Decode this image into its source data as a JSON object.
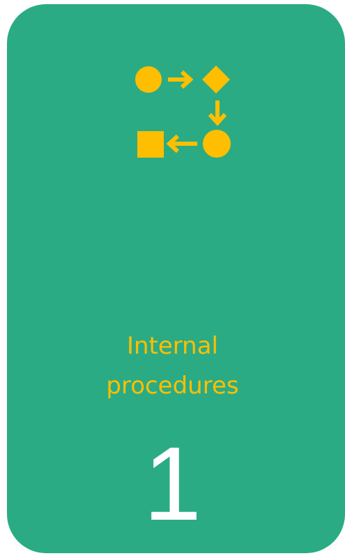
{
  "card": {
    "background_color": "#2bab84",
    "icon": {
      "name": "process-flow-icon",
      "color": "#ffbf00"
    },
    "title_line_1": "Internal",
    "title_line_2": "procedures",
    "title_color": "#ffbf00",
    "number": "1",
    "number_color": "#ffffff"
  }
}
